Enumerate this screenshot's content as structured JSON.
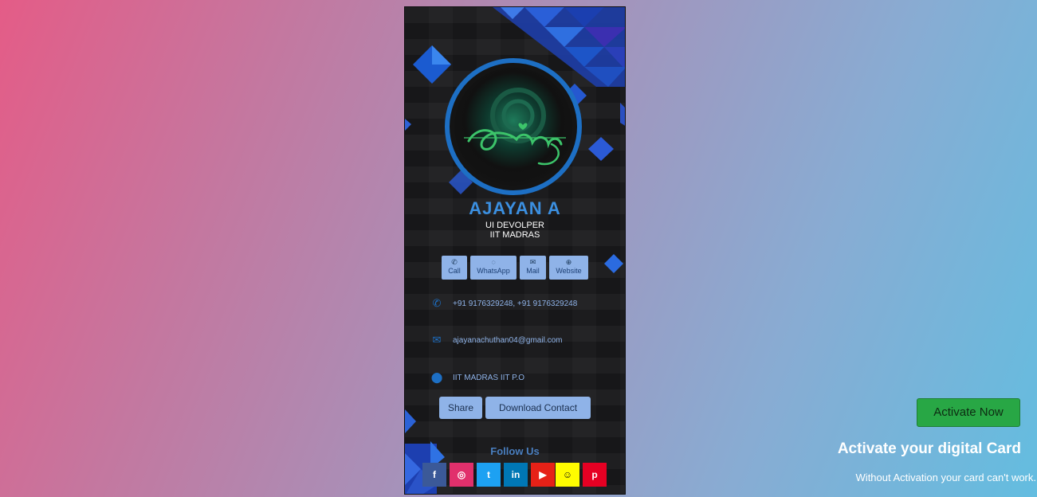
{
  "card": {
    "logo_text": "Ajayan",
    "name": "AJAYAN A",
    "role": "UI DEVOLPER",
    "org": "IIT MADRAS",
    "quick_actions": [
      {
        "label": "Call",
        "icon": "phone-icon"
      },
      {
        "label": "WhatsApp",
        "icon": "whatsapp-icon"
      },
      {
        "label": "Mail",
        "icon": "mail-icon"
      },
      {
        "label": "Website",
        "icon": "globe-icon"
      }
    ],
    "phone": "+91 9176329248, +91 9176329248",
    "email": "ajayanachuthan04@gmail.com",
    "address": "IIT MADRAS IIT P.O",
    "share_label": "Share",
    "download_label": "Download Contact",
    "follow_label": "Follow Us",
    "socials": [
      {
        "name": "facebook",
        "glyph": "f",
        "color": "#3b5998"
      },
      {
        "name": "instagram",
        "glyph": "◎",
        "color": "#e1306c"
      },
      {
        "name": "twitter",
        "glyph": "t",
        "color": "#1da1f2"
      },
      {
        "name": "linkedin",
        "glyph": "in",
        "color": "#0077b5"
      },
      {
        "name": "youtube",
        "glyph": "▶",
        "color": "#e62117"
      },
      {
        "name": "snapchat",
        "glyph": "👻",
        "color": "#fffc00"
      },
      {
        "name": "pinterest",
        "glyph": "p",
        "color": "#e60023"
      }
    ]
  },
  "activate": {
    "button_label": "Activate Now",
    "title": "Activate your digital Card",
    "subtitle": "Without Activation your card can't work."
  },
  "colors": {
    "accent_blue": "#1d6fc4",
    "button_bg": "#8fb3e8",
    "activate_green": "#28a745"
  }
}
